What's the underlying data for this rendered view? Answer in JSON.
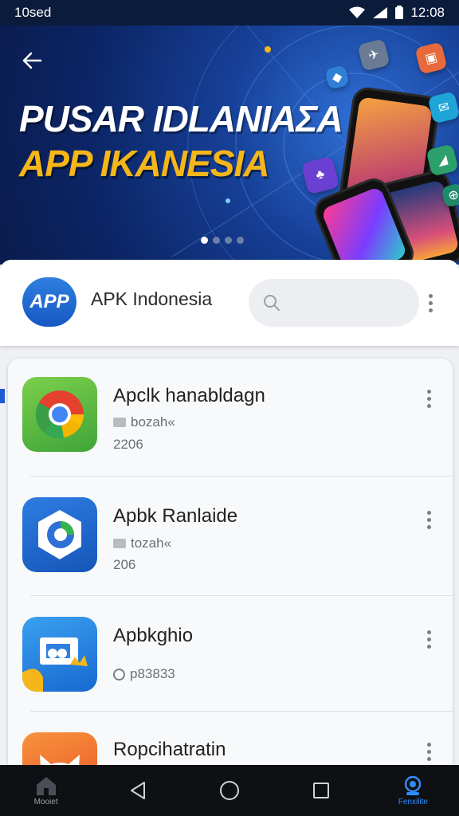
{
  "status_bar": {
    "left_text": "10sed",
    "time": "12:08"
  },
  "hero": {
    "title_line1": "PUSAR IDLANIAΣA",
    "title_line2": "APP IKANESIA",
    "slide_count": 4,
    "active_slide": 1
  },
  "header": {
    "logo_text": "APP",
    "app_name": "APK Indonesia",
    "search_placeholder": ""
  },
  "apps": [
    {
      "title": "Apclk hanabldagn",
      "meta": "bozah«",
      "sub": "2206",
      "meta_type": "square",
      "icon": "chrome-icon"
    },
    {
      "title": "Apbk Ranlaide",
      "meta": "tozah«",
      "sub": "206",
      "meta_type": "square",
      "icon": "shield-app-icon"
    },
    {
      "title": "Apbkghio",
      "meta": "p83833",
      "sub": "",
      "meta_type": "circle",
      "icon": "puzzle-app-icon"
    },
    {
      "title": "Ropcihatratin",
      "meta": "",
      "sub": "",
      "meta_type": "none",
      "icon": "cat-app-icon"
    }
  ],
  "nav": {
    "home_label": "Mooiet",
    "profile_label": "Fenxilite"
  },
  "colors": {
    "accent": "#1e5bd1",
    "hero_yellow": "#f5b619",
    "nav_blue": "#2f8cff"
  }
}
